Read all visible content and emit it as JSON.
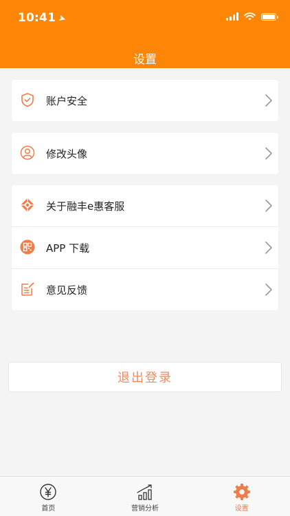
{
  "status": {
    "time": "10:41"
  },
  "header": {
    "title": "设置"
  },
  "groups": {
    "account": {
      "security": "账户安全"
    },
    "avatar": {
      "change": "修改头像"
    },
    "more": {
      "about": "关于融丰e惠客服",
      "download": "APP 下载",
      "feedback": "意见反馈"
    }
  },
  "logout": {
    "label": "退出登录"
  },
  "tabbar": {
    "home": "首页",
    "marketing": "营销分析",
    "settings": "设置",
    "active": "settings"
  },
  "colors": {
    "brand": "#fe8606",
    "accent": "#f07c4a",
    "logout_text": "#f08a5d"
  }
}
